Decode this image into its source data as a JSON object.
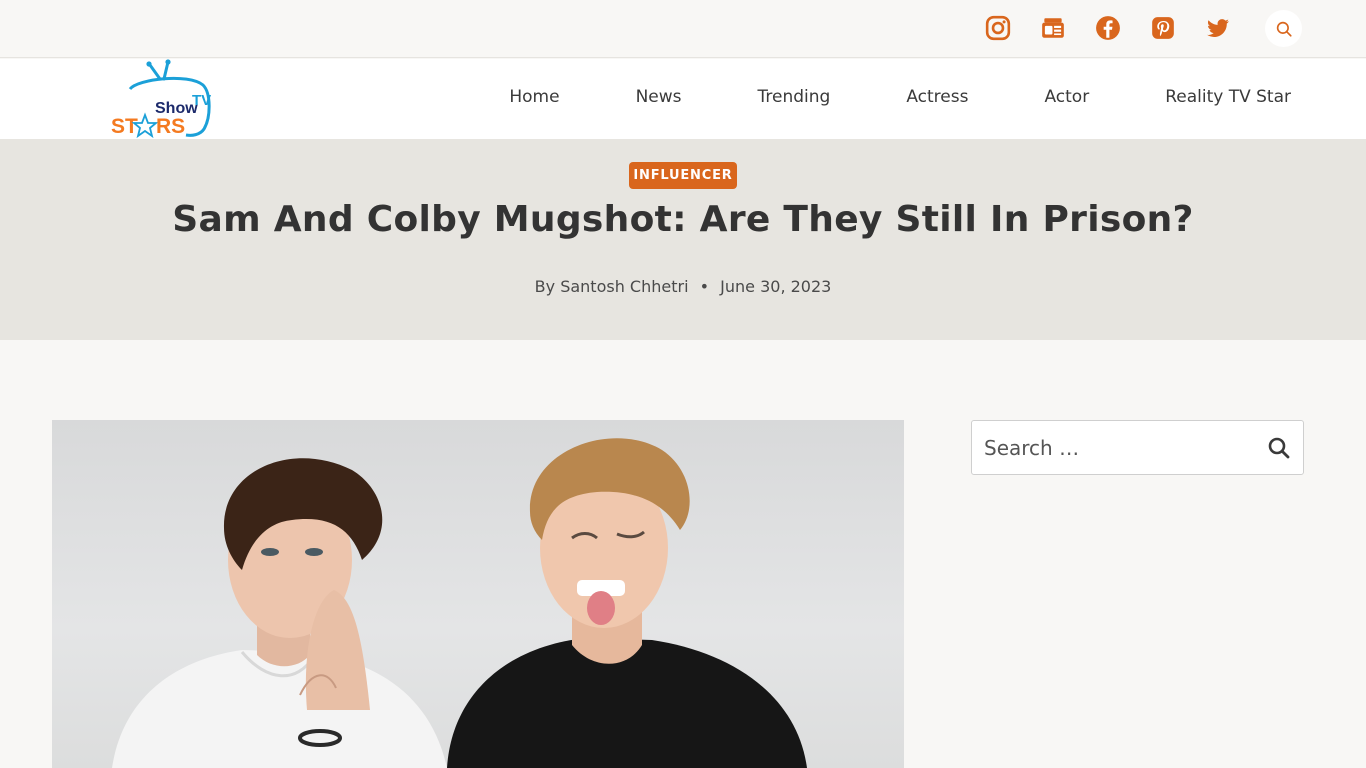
{
  "site": {
    "logo": {
      "brand_text": "Show TV STARS"
    }
  },
  "topbar": {
    "social_icons": [
      "instagram-icon",
      "google-news-icon",
      "facebook-icon",
      "pinterest-icon",
      "twitter-icon"
    ],
    "search_icon": "search-icon"
  },
  "nav": {
    "items": [
      {
        "label": "Home"
      },
      {
        "label": "News"
      },
      {
        "label": "Trending"
      },
      {
        "label": "Actress"
      },
      {
        "label": "Actor"
      },
      {
        "label": "Reality TV Star"
      }
    ]
  },
  "article": {
    "category": "INFLUENCER",
    "title": "Sam And Colby Mugshot: Are They Still In Prison?",
    "by_prefix": "By",
    "author": "Santosh Chhetri",
    "separator": "•",
    "date": "June 30, 2023"
  },
  "sidebar": {
    "search_placeholder": "Search …"
  },
  "colors": {
    "accent": "#d9661d",
    "hero_bg": "#e7e5e0",
    "page_bg": "#f8f7f5",
    "header_bg": "#ffffff",
    "title_text": "#333333"
  }
}
